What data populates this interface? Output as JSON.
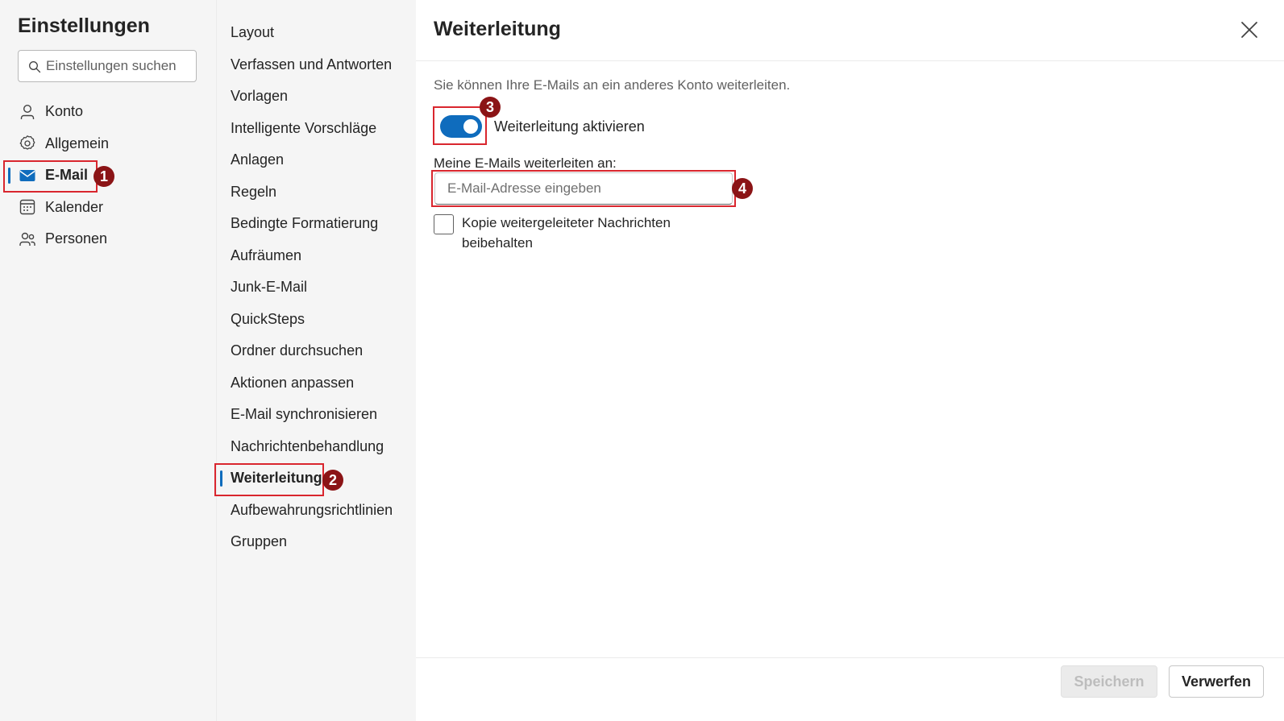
{
  "sidebar": {
    "title": "Einstellungen",
    "search_placeholder": "Einstellungen suchen",
    "items": [
      {
        "label": "Konto",
        "icon": "person-icon"
      },
      {
        "label": "Allgemein",
        "icon": "gear-icon"
      },
      {
        "label": "E-Mail",
        "icon": "mail-icon",
        "active": true
      },
      {
        "label": "Kalender",
        "icon": "calendar-icon"
      },
      {
        "label": "Personen",
        "icon": "people-icon"
      }
    ]
  },
  "subnav": {
    "items": [
      "Layout",
      "Verfassen und Antworten",
      "Vorlagen",
      "Intelligente Vorschläge",
      "Anlagen",
      "Regeln",
      "Bedingte Formatierung",
      "Aufräumen",
      "Junk-E-Mail",
      "QuickSteps",
      "Ordner durchsuchen",
      "Aktionen anpassen",
      "E-Mail synchronisieren",
      "Nachrichtenbehandlung",
      "Weiterleitung",
      "Aufbewahrungsrichtlinien",
      "Gruppen"
    ],
    "active": "Weiterleitung"
  },
  "pane": {
    "title": "Weiterleitung",
    "description": "Sie können Ihre E-Mails an ein anderes Konto weiterleiten.",
    "toggle_label": "Weiterleitung aktivieren",
    "toggle_on": true,
    "field_label": "Meine E-Mails weiterleiten an:",
    "email_placeholder": "E-Mail-Adresse eingeben",
    "email_value": "",
    "checkbox_label": "Kopie weitergeleiteter Nachrichten beibehalten",
    "checkbox_checked": false
  },
  "footer": {
    "save_label": "Speichern",
    "discard_label": "Verwerfen"
  },
  "annotations": {
    "badges": [
      "1",
      "2",
      "3",
      "4"
    ]
  },
  "colors": {
    "accent": "#0f6cbd",
    "highlight_border": "#d9262e",
    "badge_fill": "#8b1416",
    "nav_background": "#f5f5f5"
  }
}
